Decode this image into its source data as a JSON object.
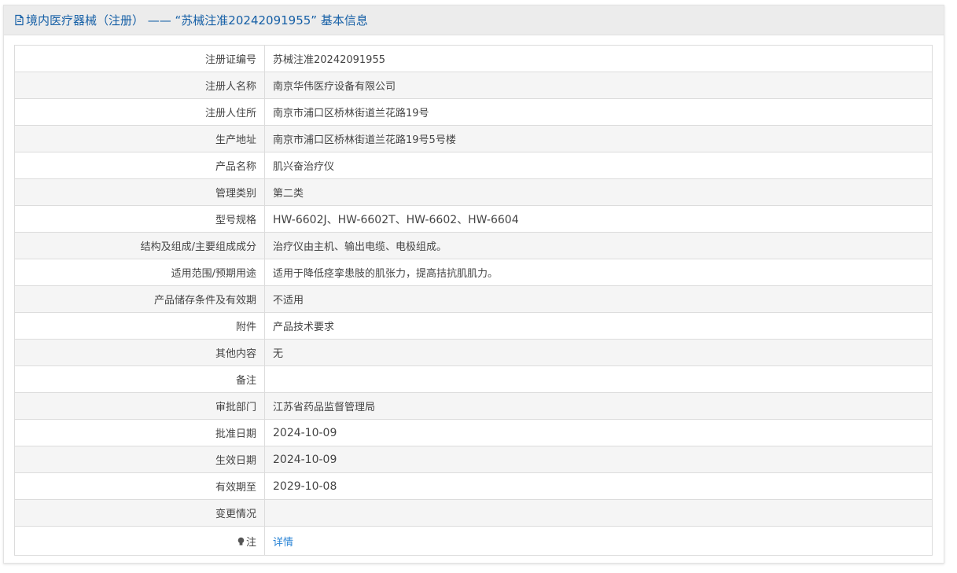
{
  "header": {
    "icon": "document-icon",
    "title": "境内医疗器械（注册） ——  “苏械注准20242091955” 基本信息"
  },
  "rows": [
    {
      "label": "注册证编号",
      "value": "苏械注准20242091955"
    },
    {
      "label": "注册人名称",
      "value": "南京华伟医疗设备有限公司"
    },
    {
      "label": "注册人住所",
      "value": "南京市浦口区桥林街道兰花路19号"
    },
    {
      "label": "生产地址",
      "value": "南京市浦口区桥林街道兰花路19号5号楼"
    },
    {
      "label": "产品名称",
      "value": "肌兴奋治疗仪"
    },
    {
      "label": "管理类别",
      "value": "第二类"
    },
    {
      "label": "型号规格",
      "value": "HW-6602J、HW-6602T、HW-6602、HW-6604"
    },
    {
      "label": "结构及组成/主要组成成分",
      "value": "治疗仪由主机、输出电缆、电极组成。"
    },
    {
      "label": "适用范围/预期用途",
      "value": "适用于降低痉挛患肢的肌张力，提高拮抗肌肌力。"
    },
    {
      "label": "产品储存条件及有效期",
      "value": "不适用"
    },
    {
      "label": "附件",
      "value": "产品技术要求"
    },
    {
      "label": "其他内容",
      "value": "无"
    },
    {
      "label": "备注",
      "value": ""
    },
    {
      "label": "审批部门",
      "value": "江苏省药品监督管理局"
    },
    {
      "label": "批准日期",
      "value": "2024-10-09"
    },
    {
      "label": "生效日期",
      "value": "2024-10-09"
    },
    {
      "label": "有效期至",
      "value": "2029-10-08"
    },
    {
      "label": "变更情况",
      "value": ""
    }
  ],
  "note": {
    "icon": "lightbulb-icon",
    "label": "注",
    "link_text": "详情",
    "link_color": "#2a84d6"
  },
  "colors": {
    "title": "#155fa6",
    "header_bg": "#ececec",
    "row_alt_bg": "#f5f5f5",
    "border": "#dcdcdc"
  }
}
